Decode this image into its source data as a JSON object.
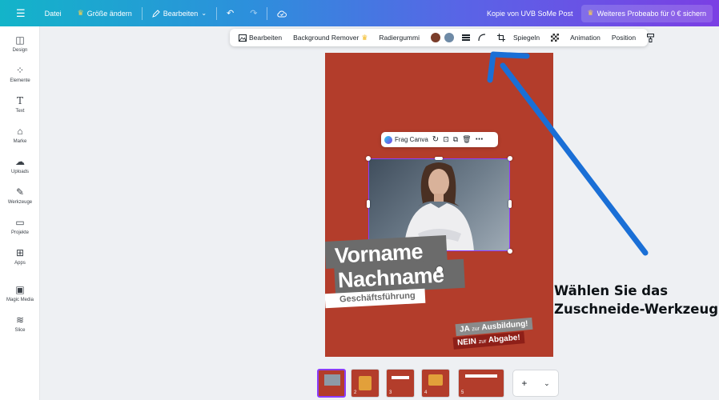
{
  "topbar": {
    "menu_icon": "hamburger-icon",
    "file": "Datei",
    "resize": "Größe ändern",
    "edit": "Bearbeiten",
    "title": "Kopie von UVB SoMe Post",
    "upgrade": "Weiteres Probeabo für 0 € sichern"
  },
  "sidebar": {
    "items": [
      {
        "label": "Design",
        "icon": "layout-icon"
      },
      {
        "label": "Elemente",
        "icon": "shapes-icon"
      },
      {
        "label": "Text",
        "icon": "text-icon"
      },
      {
        "label": "Marke",
        "icon": "brand-icon"
      },
      {
        "label": "Uploads",
        "icon": "cloud-upload-icon"
      },
      {
        "label": "Werkzeuge",
        "icon": "tools-icon"
      },
      {
        "label": "Projekte",
        "icon": "folder-icon"
      },
      {
        "label": "Apps",
        "icon": "apps-icon"
      },
      {
        "label": "Magic Media",
        "icon": "magic-media-icon"
      },
      {
        "label": "Slice",
        "icon": "slice-icon"
      }
    ]
  },
  "context_toolbar": {
    "edit": "Bearbeiten",
    "bg_remover": "Background Remover",
    "eraser": "Radiergummi",
    "flip": "Spiegeln",
    "animation": "Animation",
    "position": "Position",
    "colors": {
      "swatch1": "#7a3d2a",
      "swatch2": "#6e8aa6"
    }
  },
  "element_toolbar": {
    "ask_canva": "Frag Canva"
  },
  "canvas": {
    "first_name": "Vorname",
    "last_name": "Nachname",
    "role": "Geschäftsführung",
    "slogan1": {
      "pre": "JA",
      "mid": "zur",
      "post": "Ausbildung!"
    },
    "slogan2": {
      "pre": "NEIN",
      "mid": "zur",
      "post": "Abgabe!"
    }
  },
  "pages": {
    "numbers": [
      "",
      "2",
      "3",
      "4",
      "5"
    ],
    "add": "+"
  },
  "annotation": {
    "line1": "Wählen Sie das",
    "line2": "Zuschneide-Werkzeug"
  },
  "colors": {
    "accent": "#8b3dff",
    "page_bg": "#b33d2b",
    "arrow": "#1a6fd6"
  }
}
